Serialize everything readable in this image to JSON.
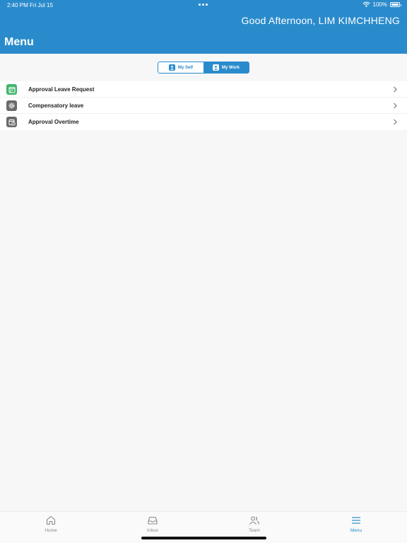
{
  "status_bar": {
    "time": "2:40 PM",
    "date": "Fri Jul 15",
    "battery": "100%"
  },
  "header": {
    "greeting": "Good Afternoon, LIM KIMCHHENG",
    "title": "Menu"
  },
  "segments": [
    {
      "label": "My Self",
      "active": false
    },
    {
      "label": "My Work",
      "active": true
    }
  ],
  "menu_items": [
    {
      "label": "Approval Leave Request",
      "icon": "calendar-check-icon",
      "color": "#3fb56b"
    },
    {
      "label": "Compensatory leave",
      "icon": "gear-icon",
      "color": "#6b6b6b"
    },
    {
      "label": "Approval Overtime",
      "icon": "calendar-clock-icon",
      "color": "#6b6b6b"
    }
  ],
  "tabs": [
    {
      "label": "Home",
      "icon": "home-icon",
      "active": false
    },
    {
      "label": "Inbox",
      "icon": "inbox-icon",
      "active": false
    },
    {
      "label": "Team",
      "icon": "team-icon",
      "active": false
    },
    {
      "label": "Menu",
      "icon": "menu-icon",
      "active": true
    }
  ],
  "colors": {
    "primary": "#2a8bcc",
    "background": "#f7f7f8",
    "tab_inactive": "#8a8a8a"
  }
}
